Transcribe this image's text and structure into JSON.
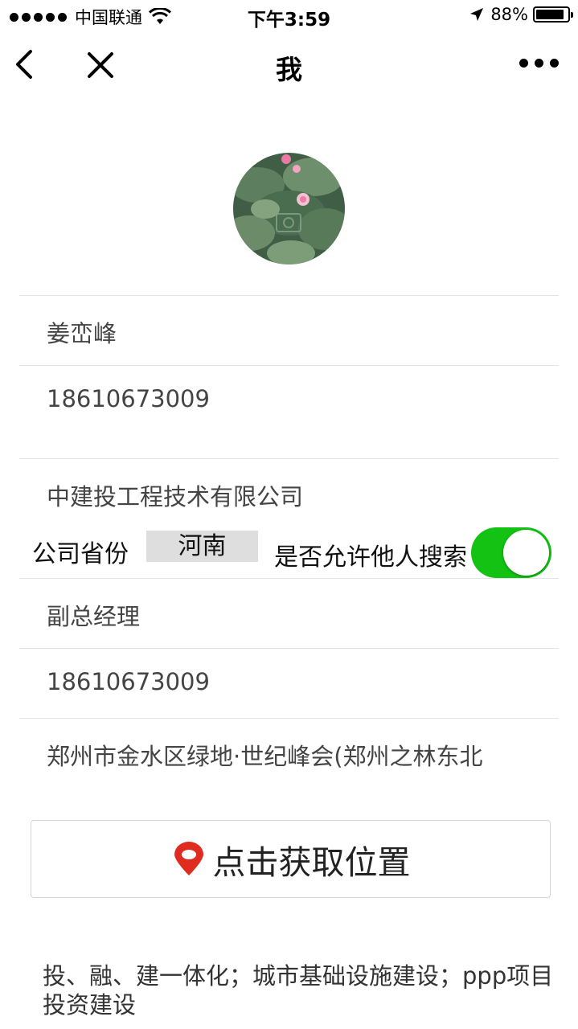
{
  "status_bar": {
    "carrier": "中国联通",
    "time": "下午3:59",
    "battery_percent": "88%"
  },
  "nav": {
    "title": "我"
  },
  "profile": {
    "name": "姜峦峰",
    "phone": "18610673009",
    "company": "中建投工程技术有限公司",
    "province_label": "公司省份",
    "province_value": "河南",
    "allow_search_label": "是否允许他人搜索",
    "allow_search_on": true,
    "position": "副总经理",
    "contact_phone": "18610673009",
    "address": "郑州市金水区绿地·世纪峰会(郑州之林东北)"
  },
  "location_button": {
    "label": "点击获取位置"
  },
  "description": "投、融、建一体化；城市基础设施建设；ppp项目投资建设",
  "colors": {
    "toggle_on": "#13c213",
    "pin_red": "#e02b1f"
  }
}
